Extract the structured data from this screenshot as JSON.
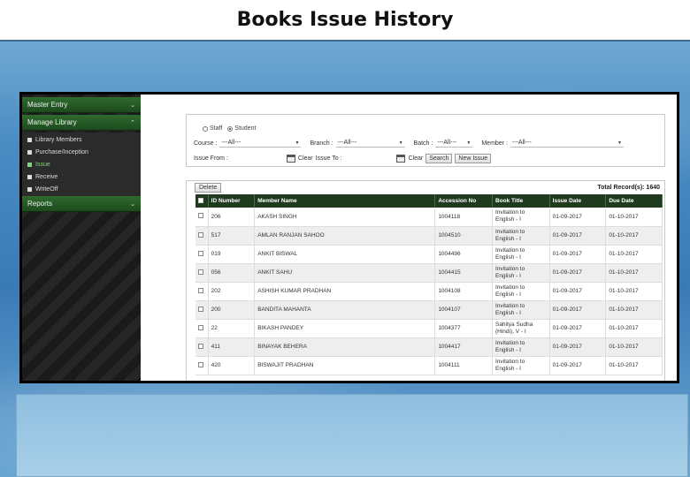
{
  "slide": {
    "title": "Books Issue History"
  },
  "sidebar": {
    "sections": [
      {
        "label": "Master Entry",
        "chevron": "⌄"
      },
      {
        "label": "Manage Library",
        "chevron": "⌃"
      },
      {
        "label": "Reports",
        "chevron": "⌄"
      }
    ],
    "items": [
      {
        "label": "Library Members"
      },
      {
        "label": "Purchase/Inception"
      },
      {
        "label": "Issue"
      },
      {
        "label": "Receive"
      },
      {
        "label": "WriteOff"
      }
    ]
  },
  "filters": {
    "radio_staff": "Staff",
    "radio_student": "Student",
    "course_label": "Course :",
    "course_value": "---All---",
    "branch_label": "Branch :",
    "branch_value": "---All---",
    "batch_label": "Batch :",
    "batch_value": "---All---",
    "member_label": "Member :",
    "member_value": "---All---",
    "issue_from_label": "Issue From :",
    "clear1": "Clear",
    "issue_to_label": "Issue To :",
    "clear2": "Clear",
    "search_btn": "Search",
    "new_issue_btn": "New Issue"
  },
  "table": {
    "delete_btn": "Delete",
    "total_records": "Total Record(s): 1640",
    "headers": {
      "id": "ID Number",
      "member": "Member Name",
      "accession": "Accession No",
      "book": "Book Title",
      "issue": "Issue Date",
      "due": "Due Date"
    },
    "rows": [
      {
        "id": "206",
        "member": "AKASH SINGH",
        "accession": "1004118",
        "book1": "Invitation to",
        "book2": "English - I",
        "issue": "01-09-2017",
        "due": "01-10-2017"
      },
      {
        "id": "517",
        "member": "AMLAN RANJAN SAHOO",
        "accession": "1004510",
        "book1": "Invitation to",
        "book2": "English - I",
        "issue": "01-09-2017",
        "due": "01-10-2017"
      },
      {
        "id": "019",
        "member": "ANKIT BISWAL",
        "accession": "1004496",
        "book1": "Invitation to",
        "book2": "English - I",
        "issue": "01-09-2017",
        "due": "01-10-2017"
      },
      {
        "id": "056",
        "member": "ANKIT SAHU",
        "accession": "1004415",
        "book1": "Invitation to",
        "book2": "English - I",
        "issue": "01-09-2017",
        "due": "01-10-2017"
      },
      {
        "id": "202",
        "member": "ASHISH KUMAR PRADHAN",
        "accession": "1004108",
        "book1": "Invitation to",
        "book2": "English - I",
        "issue": "01-09-2017",
        "due": "01-10-2017"
      },
      {
        "id": "200",
        "member": "BANDITA MAHANTA",
        "accession": "1004107",
        "book1": "Invitation to",
        "book2": "English - I",
        "issue": "01-09-2017",
        "due": "01-10-2017"
      },
      {
        "id": "22",
        "member": "BIKASH PANDEY",
        "accession": "1004377",
        "book1": "Sahitya Sudha",
        "book2": "(Hindi), V - I",
        "issue": "01-09-2017",
        "due": "01-10-2017"
      },
      {
        "id": "411",
        "member": "BINAYAK BEHERA",
        "accession": "1004417",
        "book1": "Invitation to",
        "book2": "English - I",
        "issue": "01-09-2017",
        "due": "01-10-2017"
      },
      {
        "id": "420",
        "member": "BISWAJIT PRADHAN",
        "accession": "1004111",
        "book1": "Invitation to",
        "book2": "English - I",
        "issue": "01-09-2017",
        "due": "01-10-2017"
      }
    ]
  }
}
